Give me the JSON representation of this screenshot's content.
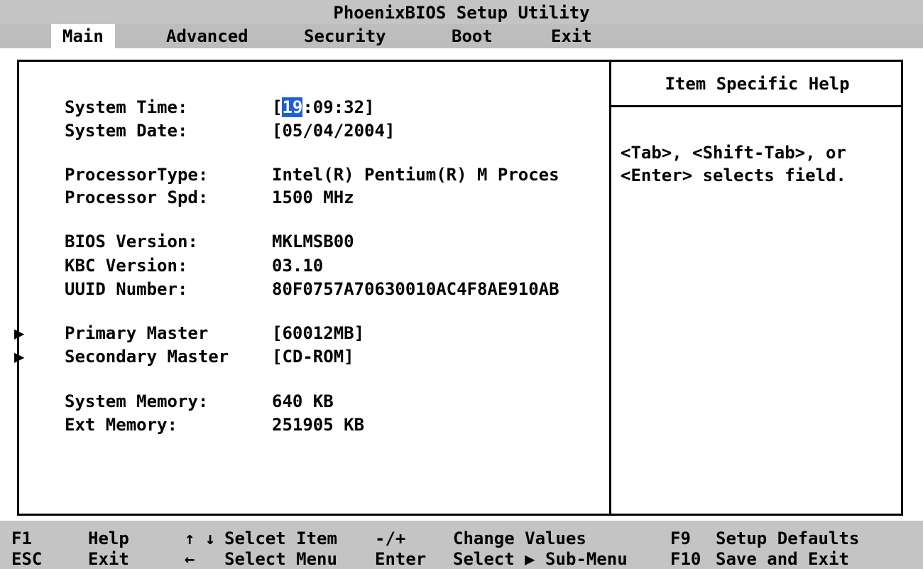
{
  "title": "PhoenixBIOS Setup Utility",
  "menu": [
    {
      "label": "Main",
      "active": true
    },
    {
      "label": "Advanced",
      "active": false
    },
    {
      "label": "Security",
      "active": false
    },
    {
      "label": "Boot",
      "active": false
    },
    {
      "label": "Exit",
      "active": false
    }
  ],
  "main": {
    "system_time": {
      "label": "System Time:",
      "open": "[",
      "hour": "19",
      "rest": ":09:32]"
    },
    "system_date": {
      "label": "System Date:",
      "value": "[05/04/2004]"
    },
    "processor_type": {
      "label": "ProcessorType:",
      "value": "Intel(R) Pentium(R) M Proces"
    },
    "processor_spd": {
      "label": "Processor Spd:",
      "value": "1500 MHz"
    },
    "bios_version": {
      "label": "BIOS Version:",
      "value": "MKLMSB00"
    },
    "kbc_version": {
      "label": "KBC Version:",
      "value": "03.10"
    },
    "uuid": {
      "label": "UUID Number:",
      "value": "80F0757A70630010AC4F8AE910AB"
    },
    "primary_master": {
      "label": "Primary Master",
      "value": "[60012MB]"
    },
    "secondary_master": {
      "label": "Secondary Master",
      "value": "[CD-ROM]"
    },
    "system_memory": {
      "label": "System Memory:",
      "value": "640 KB"
    },
    "ext_memory": {
      "label": "Ext Memory:",
      "value": "251905 KB"
    },
    "submenu_glyph": "▶"
  },
  "help": {
    "title": "Item Specific Help",
    "line1": "<Tab>, <Shift-Tab>, or",
    "line2": "<Enter> selects field."
  },
  "footer": {
    "row1": [
      {
        "key": "F1",
        "desc": "Help"
      },
      {
        "key": "↑ ↓",
        "desc": "Selcet Item"
      },
      {
        "key": "-/+",
        "desc": "Change Values"
      },
      {
        "key": "F9",
        "desc": "Setup Defaults"
      }
    ],
    "row2": [
      {
        "key": "ESC",
        "desc": "Exit"
      },
      {
        "key": "←",
        "desc": "Select Menu"
      },
      {
        "key": "Enter",
        "desc": "Select ▶ Sub-Menu"
      },
      {
        "key": "F10",
        "desc": "Save and Exit"
      }
    ]
  },
  "colors": {
    "highlight": "#1f5fd6",
    "bar": "#c4c4c4",
    "background": "#ffffff"
  }
}
